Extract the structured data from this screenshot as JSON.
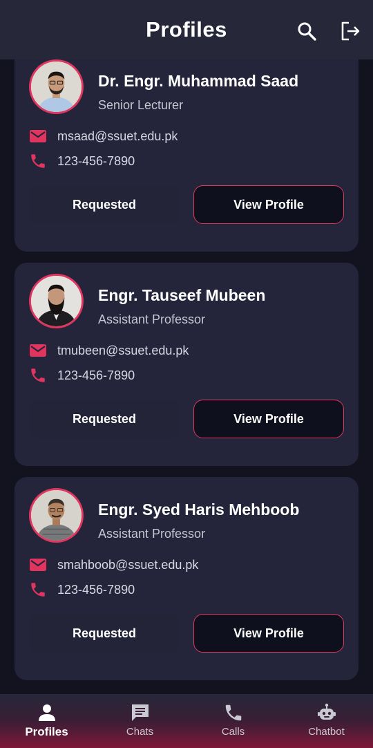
{
  "header": {
    "title": "Profiles",
    "search_icon": "search-icon",
    "logout_icon": "logout-icon"
  },
  "profiles": [
    {
      "name": "Dr. Engr. Muhammad Saad",
      "role": "Senior Lecturer",
      "email": "msaad@ssuet.edu.pk",
      "phone": "123-456-7890",
      "status_label": "Requested",
      "view_label": "View Profile"
    },
    {
      "name": "Engr. Tauseef Mubeen",
      "role": "Assistant Professor",
      "email": "tmubeen@ssuet.edu.pk",
      "phone": "123-456-7890",
      "status_label": "Requested",
      "view_label": "View Profile"
    },
    {
      "name": "Engr. Syed Haris Mehboob",
      "role": "Assistant Professor",
      "email": "smahboob@ssuet.edu.pk",
      "phone": "123-456-7890",
      "status_label": "Requested",
      "view_label": "View Profile"
    }
  ],
  "bottom_nav": {
    "items": [
      {
        "label": "Profiles",
        "icon": "person-icon",
        "active": true
      },
      {
        "label": "Chats",
        "icon": "chat-icon",
        "active": false
      },
      {
        "label": "Calls",
        "icon": "phone-icon",
        "active": false
      },
      {
        "label": "Chatbot",
        "icon": "robot-icon",
        "active": false
      }
    ]
  },
  "colors": {
    "accent": "#e0355e",
    "background": "#12131f",
    "card": "#24253a",
    "header": "#262739"
  }
}
